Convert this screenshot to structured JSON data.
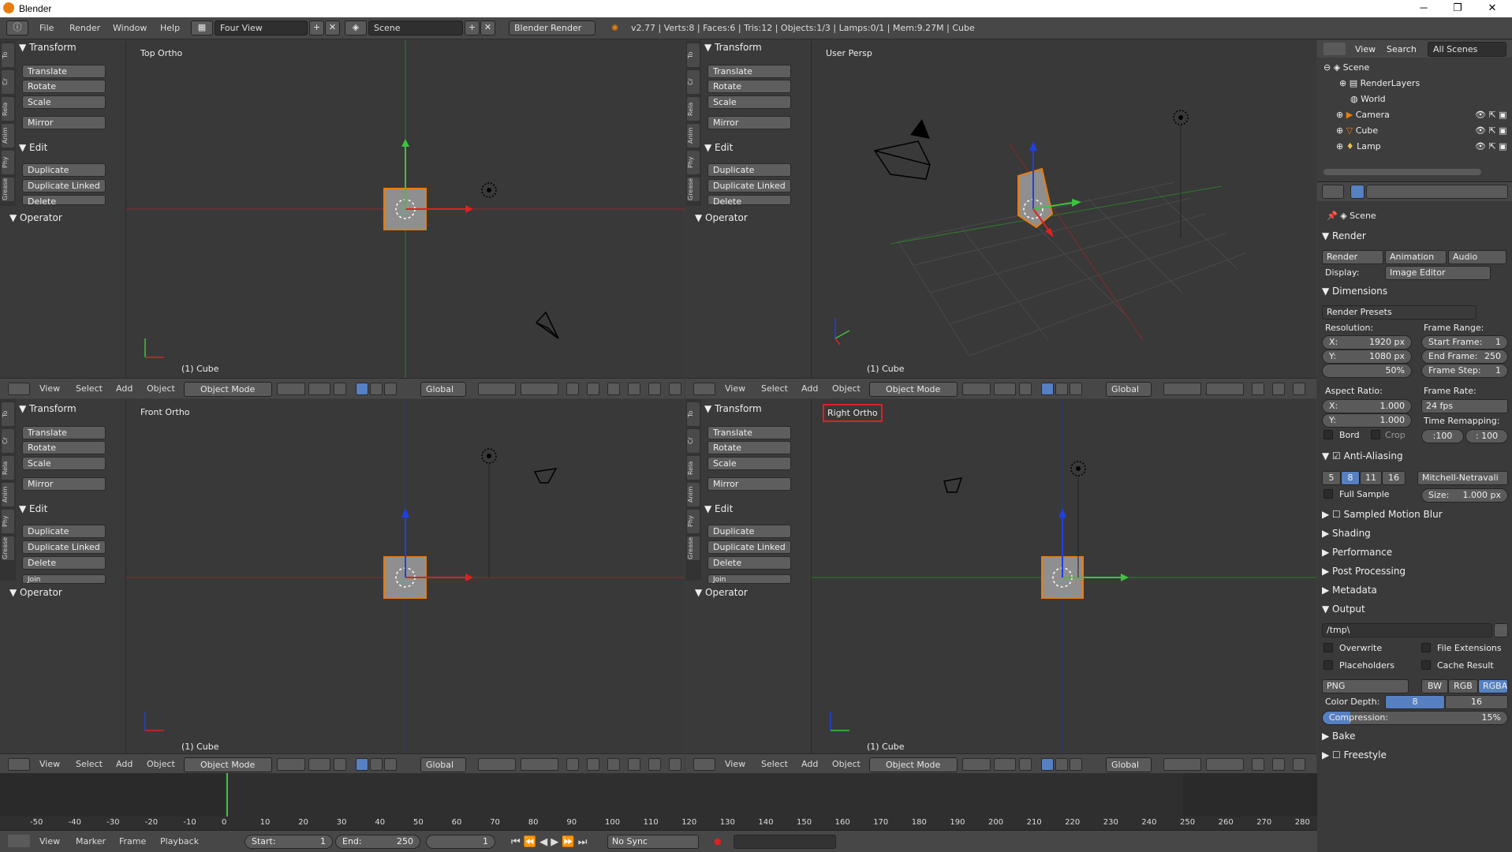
{
  "window": {
    "title": "Blender"
  },
  "menu": [
    "File",
    "Render",
    "Window",
    "Help"
  ],
  "layout": "Four View",
  "scene": "Scene",
  "engine": "Blender Render",
  "stats": "v2.77 | Verts:8 | Faces:6 | Tris:12 | Objects:1/3 | Lamps:0/1 | Mem:9.27M | Cube",
  "toolshelf": {
    "tabs": [
      "To",
      "Cr",
      "Rela",
      "Anim",
      "Phy",
      "Grease"
    ],
    "transform": "Transform",
    "translate": "Translate",
    "rotate": "Rotate",
    "scale": "Scale",
    "mirror": "Mirror",
    "edit": "Edit",
    "duplicate": "Duplicate",
    "duplicate_linked": "Duplicate Linked",
    "delete": "Delete",
    "join": "Join",
    "operator": "Operator"
  },
  "views": {
    "top": "Top Ortho",
    "persp": "User Persp",
    "front": "Front Ortho",
    "right": "Right Ortho",
    "footer": "(1) Cube"
  },
  "viewheader": {
    "menu": [
      "View",
      "Select",
      "Add",
      "Object"
    ],
    "mode": "Object Mode",
    "orientation": "Global"
  },
  "outliner": {
    "menu": [
      "View",
      "Search"
    ],
    "filter": "All Scenes",
    "items": [
      "Scene",
      "RenderLayers",
      "World",
      "Camera",
      "Cube",
      "Lamp"
    ]
  },
  "props": {
    "scene": "Scene",
    "render": "Render",
    "render_btn": "Render",
    "animation_btn": "Animation",
    "audio_btn": "Audio",
    "display_label": "Display:",
    "display": "Image Editor",
    "dimensions": "Dimensions",
    "presets": "Render Presets",
    "resolution": "Resolution:",
    "res_x": "X:",
    "res_x_val": "1920 px",
    "res_y": "Y:",
    "res_y_val": "1080 px",
    "res_pct": "50%",
    "frame_range": "Frame Range:",
    "start_frame": "Start Frame:",
    "start_frame_val": "1",
    "end_frame": "End Frame:",
    "end_frame_val": "250",
    "frame_step": "Frame Step:",
    "frame_step_val": "1",
    "aspect": "Aspect Ratio:",
    "asp_x": "X:",
    "asp_x_val": "1.000",
    "asp_y": "Y:",
    "asp_y_val": "1.000",
    "frame_rate": "Frame Rate:",
    "fps": "24 fps",
    "time_remap": "Time Remapping:",
    "remap_old": ":100",
    "remap_new": ": 100",
    "bord": "Bord",
    "crop": "Crop",
    "aa": "Anti-Aliasing",
    "aa_levels": [
      "5",
      "8",
      "11",
      "16"
    ],
    "aa_filter": "Mitchell-Netravali",
    "full_sample": "Full Sample",
    "size": "Size:",
    "size_val": "1.000 px",
    "smb": "Sampled Motion Blur",
    "shading": "Shading",
    "performance": "Performance",
    "post": "Post Processing",
    "metadata": "Metadata",
    "output": "Output",
    "path": "/tmp\\",
    "overwrite": "Overwrite",
    "file_ext": "File Extensions",
    "placeholders": "Placeholders",
    "cache": "Cache Result",
    "format": "PNG",
    "bw": "BW",
    "rgb": "RGB",
    "rgba": "RGBA",
    "color_depth": "Color Depth:",
    "depth8": "8",
    "depth16": "16",
    "compression": "Compression:",
    "compression_val": "15%",
    "bake": "Bake",
    "freestyle": "Freestyle"
  },
  "timeline": {
    "ticks": [
      "-50",
      "-40",
      "-30",
      "-20",
      "-10",
      "0",
      "10",
      "20",
      "30",
      "40",
      "50",
      "60",
      "70",
      "80",
      "90",
      "100",
      "110",
      "120",
      "130",
      "140",
      "150",
      "160",
      "170",
      "180",
      "190",
      "200",
      "210",
      "220",
      "230",
      "240",
      "250",
      "260",
      "270",
      "280"
    ],
    "menu": [
      "View",
      "Marker",
      "Frame",
      "Playback"
    ],
    "start_label": "Start:",
    "start": "1",
    "end_label": "End:",
    "end": "250",
    "current": "1",
    "sync": "No Sync"
  },
  "colors": {
    "accent": "#5680c2",
    "x_axis": "#e02020",
    "y_axis": "#3fc23f",
    "z_axis": "#2040e0",
    "select_outline": "#e87d0d",
    "highlight_box": "#e02020"
  }
}
